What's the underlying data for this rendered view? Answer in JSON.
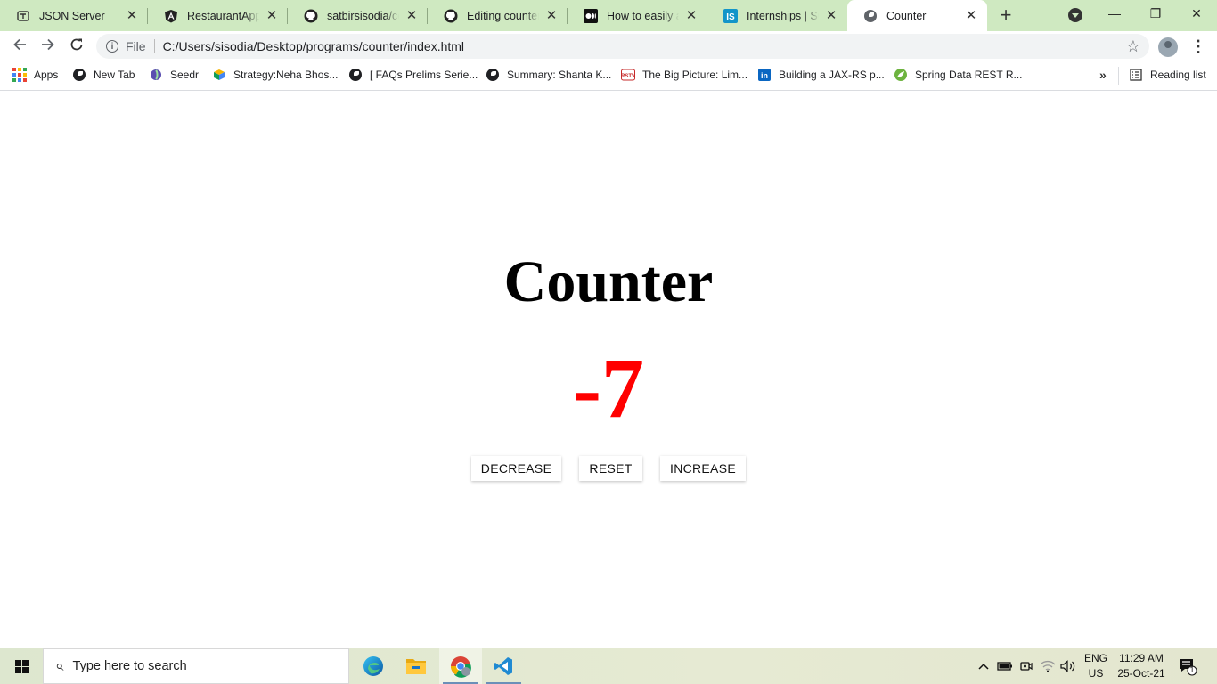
{
  "browser": {
    "tabs": [
      {
        "title": "JSON Server",
        "icon": "json-server-icon",
        "active": false
      },
      {
        "title": "RestaurantApp",
        "icon": "angular-icon",
        "active": false
      },
      {
        "title": "satbirsisodia/counter",
        "icon": "github-icon",
        "active": false
      },
      {
        "title": "Editing counter-p",
        "icon": "github-icon",
        "active": false
      },
      {
        "title": "How to easily add",
        "icon": "medium-icon",
        "active": false
      },
      {
        "title": "Internships | Summ",
        "icon": "internshala-icon",
        "active": false
      },
      {
        "title": "Counter",
        "icon": "globe-icon",
        "active": true
      }
    ],
    "close_glyph": "✕",
    "new_tab_glyph": "+",
    "window_controls": {
      "minimize": "—",
      "restore": "❐",
      "close": "✕"
    },
    "address": {
      "scheme_label": "File",
      "url": "C:/Users/sisodia/Desktop/programs/counter/index.html"
    },
    "bookmarks": [
      {
        "label": "Apps",
        "icon": "apps-grid-icon"
      },
      {
        "label": "New Tab",
        "icon": "globe-icon"
      },
      {
        "label": "Seedr",
        "icon": "seedr-icon"
      },
      {
        "label": "Strategy:Neha Bhos...",
        "icon": "cube-icon"
      },
      {
        "label": "[ FAQs Prelims Serie...",
        "icon": "globe-icon"
      },
      {
        "label": "Summary: Shanta K...",
        "icon": "globe-icon"
      },
      {
        "label": "The Big Picture: Lim...",
        "icon": "rstv-icon"
      },
      {
        "label": "Building a JAX-RS p...",
        "icon": "linkedin-icon"
      },
      {
        "label": "Spring Data REST R...",
        "icon": "spring-icon"
      }
    ],
    "bookmarks_more": "»",
    "reading_list": "Reading list"
  },
  "page": {
    "heading": "Counter",
    "count": "-7",
    "count_color": "#ff0000",
    "buttons": {
      "decrease": "DECREASE",
      "reset": "RESET",
      "increase": "INCREASE"
    }
  },
  "taskbar": {
    "search_placeholder": "Type here to search",
    "pinned_apps": [
      "edge-icon",
      "file-explorer-icon",
      "chrome-icon",
      "vscode-icon"
    ],
    "language": "ENG",
    "region": "US",
    "time": "11:29 AM",
    "date": "25-Oct-21",
    "notification_count": "1"
  }
}
